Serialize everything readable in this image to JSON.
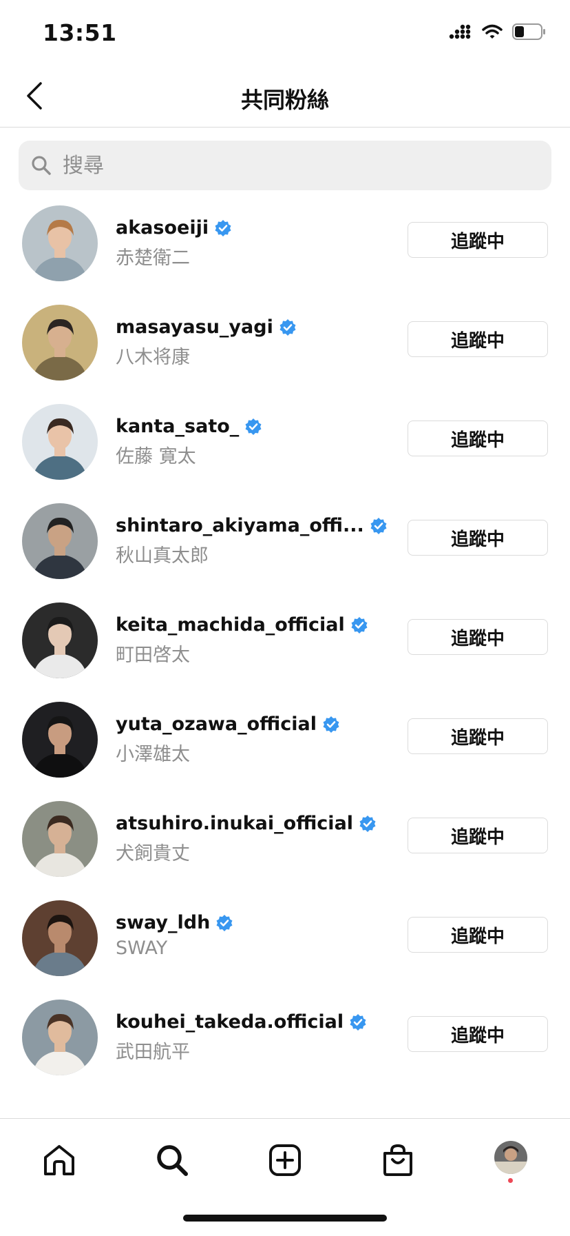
{
  "status_bar": {
    "time": "13:51",
    "battery_level": 0.35
  },
  "header": {
    "title": "共同粉絲"
  },
  "search": {
    "placeholder": "搜尋",
    "value": ""
  },
  "users": [
    {
      "username": "akasoeiji",
      "name": "赤楚衛二",
      "verified": true,
      "button": "追蹤中"
    },
    {
      "username": "masayasu_yagi",
      "name": "八木将康",
      "verified": true,
      "button": "追蹤中"
    },
    {
      "username": "kanta_sato_",
      "name": "佐藤 寛太",
      "verified": true,
      "button": "追蹤中"
    },
    {
      "username": "shintaro_akiyama_offi...",
      "name": "秋山真太郎",
      "verified": true,
      "button": "追蹤中"
    },
    {
      "username": "keita_machida_official",
      "name": "町田啓太",
      "verified": true,
      "button": "追蹤中"
    },
    {
      "username": "yuta_ozawa_official",
      "name": "小澤雄太",
      "verified": true,
      "button": "追蹤中"
    },
    {
      "username": "atsuhiro.inukai_official",
      "name": "犬飼貴丈",
      "verified": true,
      "button": "追蹤中"
    },
    {
      "username": "sway_ldh",
      "name": "SWAY",
      "verified": true,
      "button": "追蹤中"
    },
    {
      "username": "kouhei_takeda.official",
      "name": "武田航平",
      "verified": true,
      "button": "追蹤中"
    }
  ],
  "tab_bar": {
    "tabs": [
      {
        "icon": "home-icon"
      },
      {
        "icon": "search-icon",
        "active": true
      },
      {
        "icon": "add-post-icon"
      },
      {
        "icon": "shop-icon"
      },
      {
        "icon": "profile-avatar",
        "notification_dot": true
      }
    ]
  },
  "colors": {
    "verified": "#3897f0",
    "notification": "#ed4956",
    "secondary_text": "#8e8e8e",
    "border": "#dbdbdb",
    "search_bg": "#efefef"
  }
}
